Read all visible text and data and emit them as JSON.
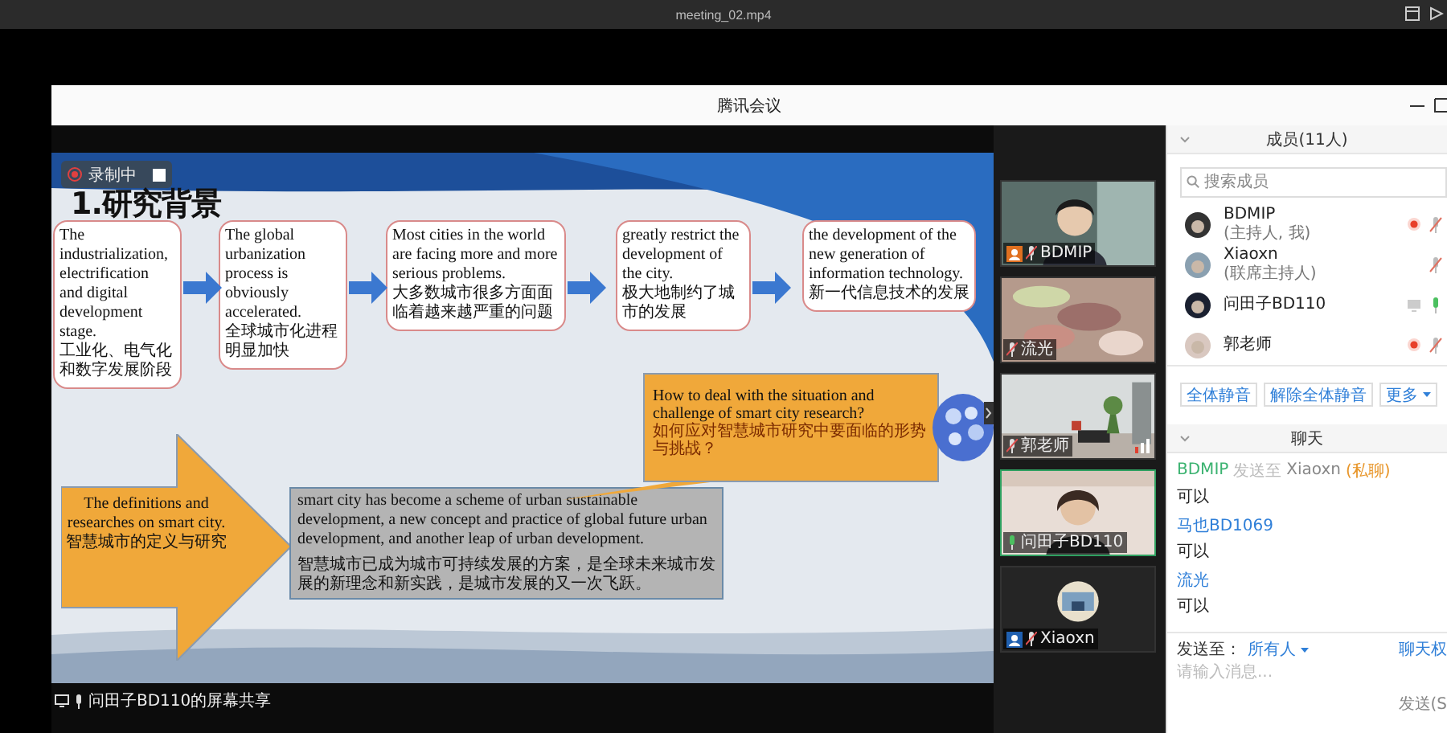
{
  "player": {
    "filename": "meeting_02.mp4"
  },
  "window": {
    "title": "腾讯会议"
  },
  "recording": {
    "label": "录制中"
  },
  "slide": {
    "title": "1.研究背景",
    "flow_boxes": [
      {
        "en": "The industrialization, electrification and digital development stage.",
        "zh": "工业化、电气化和数字发展阶段"
      },
      {
        "en": "The global urbanization process is obviously accelerated.",
        "zh": "全球城市化进程明显加快"
      },
      {
        "en": "Most cities in the world are facing more and more serious problems.",
        "zh": "大多数城市很多方面面临着越来越严重的问题"
      },
      {
        "en": "greatly restrict the development of the city.",
        "zh": "极大地制约了城市的发展"
      },
      {
        "en": "the development of the new generation of information technology.",
        "zh": "新一代信息技术的发展"
      }
    ],
    "callout": {
      "en": "How to deal with the situation and challenge of smart city research?",
      "zh": "如何应对智慧城市研究中要面临的形势与挑战？"
    },
    "arrow_label": {
      "en": "The definitions and researches on smart city.",
      "zh": "智慧城市的定义与研究"
    },
    "summary": {
      "en": "smart city has become a scheme of urban sustainable development, a new concept and practice of global future urban development, and another leap of urban development.",
      "zh": "智慧城市已成为城市可持续发展的方案，是全球未来城市发展的新理念和新实践，是城市发展的又一次飞跃。"
    }
  },
  "share_label": "问田子BD110的屏幕共享",
  "video_tiles": [
    {
      "name": "BDMIP",
      "kind": "host",
      "speaking": false,
      "signal": false,
      "mic_on": false
    },
    {
      "name": "流光",
      "kind": "guest",
      "speaking": false,
      "signal": false,
      "mic_on": false
    },
    {
      "name": "郭老师",
      "kind": "guest",
      "speaking": false,
      "signal": true,
      "mic_on": false
    },
    {
      "name": "问田子BD110",
      "kind": "guest",
      "speaking": true,
      "signal": false,
      "mic_on": true
    },
    {
      "name": "Xiaoxn",
      "kind": "cohost",
      "speaking": false,
      "signal": false,
      "mic_on": false
    }
  ],
  "members": {
    "title": "成员(11人)",
    "search_placeholder": "搜索成员",
    "list": [
      {
        "name": "BDMIP",
        "role": "(主持人, 我)",
        "recording": true,
        "sharing": false,
        "mic_on": false
      },
      {
        "name": "Xiaoxn",
        "role": "(联席主持人)",
        "recording": false,
        "sharing": false,
        "mic_on": false
      },
      {
        "name": "问田子BD110",
        "recording": false,
        "sharing": true,
        "mic_on": true
      },
      {
        "name": "郭老师",
        "recording": true,
        "sharing": false,
        "mic_on": false
      }
    ],
    "buttons": [
      "全体静音",
      "解除全体静音",
      "更多"
    ]
  },
  "chat": {
    "title": "聊天",
    "messages": [
      {
        "sender": "BDMIP",
        "color": "#3cb371",
        "to_label": "发送至",
        "to": "Xiaoxn",
        "tag": "(私聊)",
        "text": "可以"
      },
      {
        "sender": "马也BD1069",
        "color": "#2f7fd8",
        "text": "可以"
      },
      {
        "sender": "流光",
        "color": "#2f7fd8",
        "text": "可以"
      }
    ],
    "send_to_label": "发送至：",
    "recipient": "所有人",
    "permission_link": "聊天权",
    "placeholder": "请输入消息...",
    "send_button": "发送(S"
  }
}
